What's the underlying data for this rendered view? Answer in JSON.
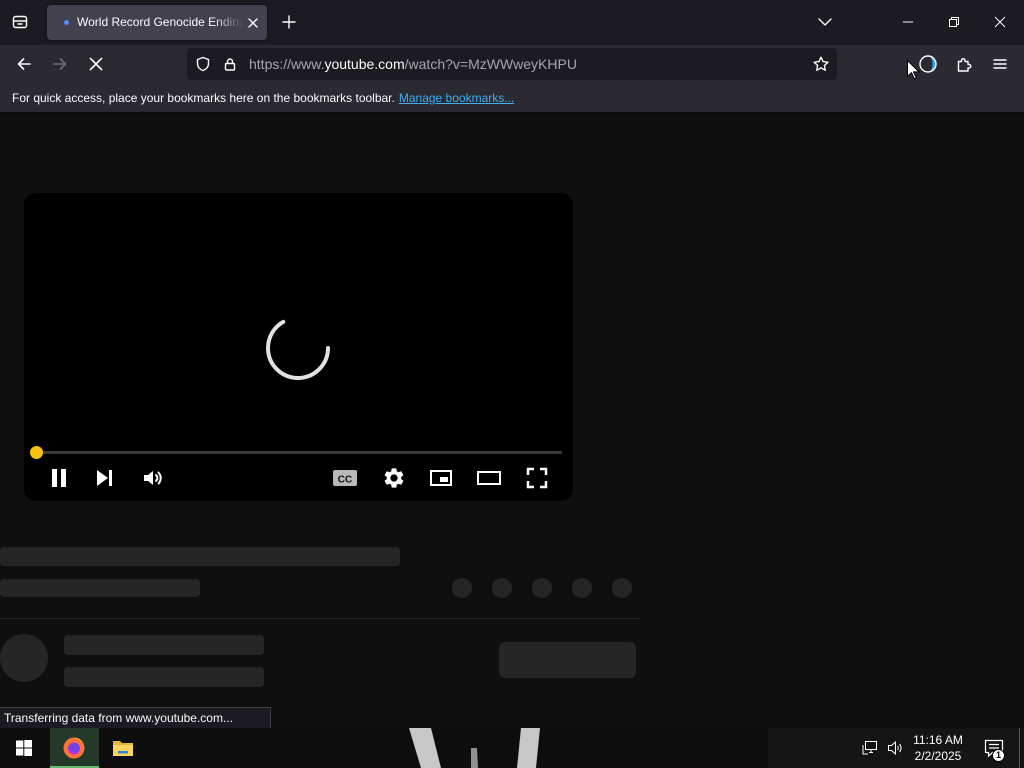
{
  "browser": {
    "firefox_view_icon": "firefox-view-icon",
    "tab": {
      "title": "World Record Genocide Ending",
      "loading": true,
      "close_icon": "close-icon"
    },
    "new_tab_icon": "plus-icon",
    "list_all_tabs_icon": "chevron-down-icon",
    "window_controls": [
      "minimize-icon",
      "restore-icon",
      "close-icon"
    ]
  },
  "navigation": {
    "back_icon": "arrow-left-icon",
    "forward_icon": "arrow-right-icon",
    "forward_enabled": false,
    "stop_icon": "stop-icon"
  },
  "urlbar": {
    "tracking_protection_icon": "shield-icon",
    "security_icon": "lock-icon",
    "url_prefix": "https://www.",
    "url_domain": "youtube.com",
    "url_path": "/watch?v=MzWWweyKHPU",
    "bookmark_icon": "star-icon"
  },
  "toolbar_right": [
    "account-icon",
    "extensions-icon",
    "menu-icon"
  ],
  "bookmarks_toolbar": {
    "message": "For quick access, place your bookmarks here on the bookmarks toolbar.",
    "manage_link": "Manage bookmarks..."
  },
  "player": {
    "loading": true,
    "progress": 0,
    "captions_label": "CC",
    "controls": [
      "pause-icon",
      "next-icon",
      "volume-icon",
      "captions-icon",
      "settings-icon",
      "miniplayer-icon",
      "theater-mode-icon",
      "fullscreen-icon"
    ]
  },
  "status_panel": {
    "text": "Transferring data from www.youtube.com..."
  },
  "taskbar": {
    "apps": [
      "windows-start-icon",
      "firefox-icon",
      "file-explorer-icon"
    ],
    "tray_icons": [
      "network-icon",
      "volume-icon",
      "notification-icon"
    ],
    "clock_time": "11:16 AM",
    "clock_date": "2/2/2025",
    "notification_count": "1"
  },
  "colors": {
    "tab_bar": "#1c1b22",
    "toolbar": "#2b2a33",
    "active_tab": "#42414d",
    "urlbar": "#1c1b22",
    "page_background": "#0f0f0f",
    "skeleton": "#262626",
    "scrubber": "#f6c20f",
    "link": "#3fb0f0",
    "loading_dot": "#5b8ff6"
  }
}
